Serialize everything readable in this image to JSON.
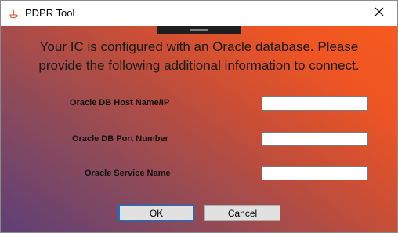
{
  "window": {
    "title": "PDPR Tool",
    "app_icon": "java-cup-icon",
    "close_icon": "close-icon"
  },
  "message": {
    "line1": "Your IC is configured with an Oracle database. Please",
    "line2": "provide the following additional information to connect."
  },
  "form": {
    "fields": [
      {
        "label": "Oracle DB Host Name/IP",
        "value": ""
      },
      {
        "label": "Oracle DB Port Number",
        "value": ""
      },
      {
        "label": "Oracle Service Name",
        "value": ""
      }
    ]
  },
  "buttons": {
    "ok_label": "OK",
    "cancel_label": "Cancel"
  },
  "colors": {
    "gradient_start": "#5e3f77",
    "gradient_end": "#f65a1f",
    "default_button_border": "#0078d7"
  }
}
